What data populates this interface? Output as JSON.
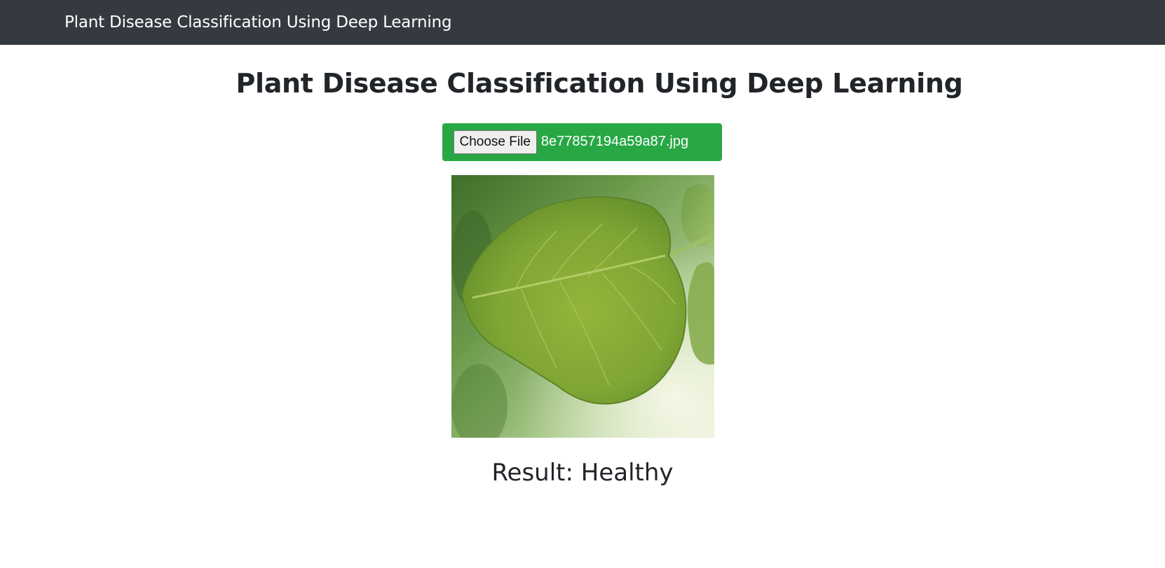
{
  "navbar": {
    "brand": "Plant Disease Classification Using Deep Learning"
  },
  "main": {
    "title": "Plant Disease Classification Using Deep Learning",
    "upload": {
      "button_label": "Choose File",
      "file_name": "8e77857194a59a87.jpg"
    },
    "result_label": "Result:",
    "result_value": "Healthy"
  },
  "colors": {
    "navbar_bg": "#343a40",
    "upload_bg": "#28a745",
    "text": "#212529"
  }
}
